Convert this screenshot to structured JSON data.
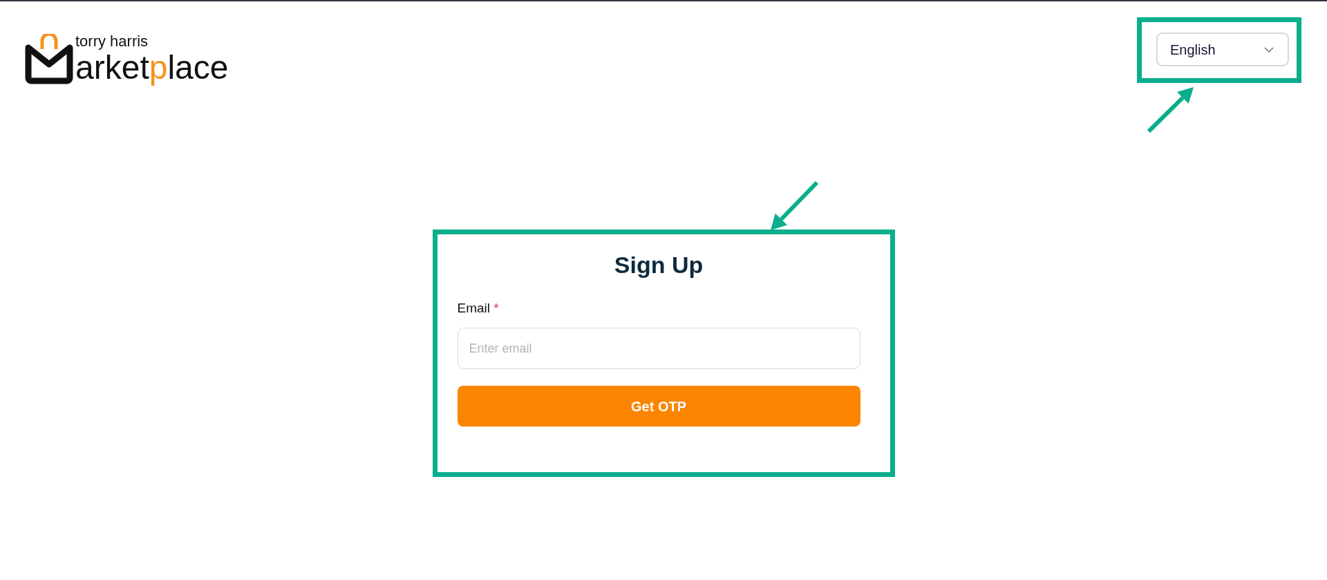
{
  "logo": {
    "tagline": "torry harris",
    "wordmark": [
      {
        "text": "arket",
        "accent": false
      },
      {
        "text": "p",
        "accent": true
      },
      {
        "text": "lace",
        "accent": false
      }
    ]
  },
  "language_select": {
    "value": "English",
    "highlighted": true
  },
  "signup": {
    "highlighted": true,
    "title": "Sign Up",
    "fields": [
      {
        "label": "Email",
        "required": true,
        "required_mark": "*",
        "placeholder": "Enter email"
      }
    ],
    "button": "Get OTP"
  }
}
